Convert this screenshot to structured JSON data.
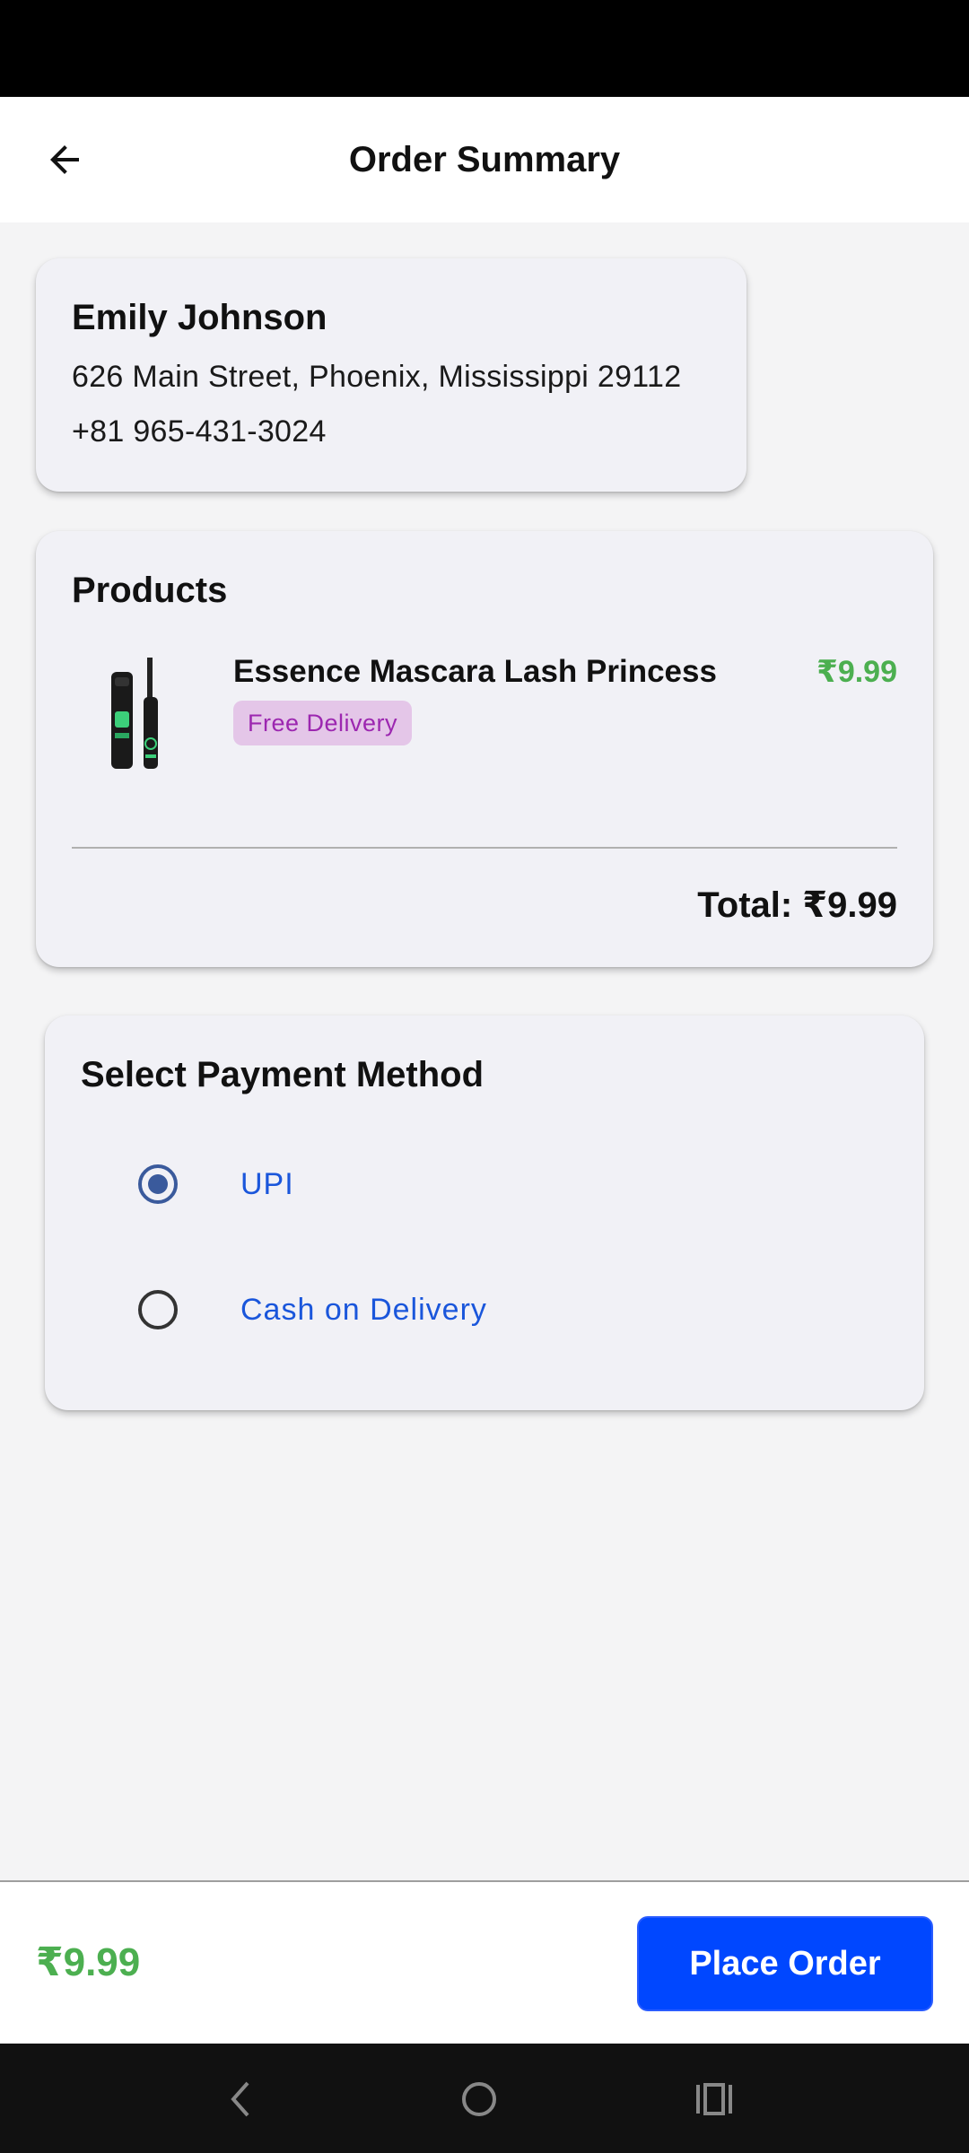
{
  "app_bar": {
    "title": "Order Summary",
    "back_icon": "arrow-left-icon"
  },
  "address": {
    "name": "Emily Johnson",
    "line1": "626 Main Street, Phoenix, Mississippi 29112",
    "phone": "+81 965-431-3024"
  },
  "products": {
    "title": "Products",
    "items": [
      {
        "name": "Essence Mascara Lash Princess",
        "price": "₹9.99",
        "badge": "Free Delivery",
        "image": "mascara-product-image"
      }
    ],
    "total": "Total: ₹9.99"
  },
  "payment": {
    "title": "Select Payment Method",
    "options": [
      {
        "label": "UPI",
        "selected": true
      },
      {
        "label": "Cash on Delivery",
        "selected": false
      }
    ]
  },
  "bottom": {
    "price": "₹9.99",
    "place_order_label": "Place Order"
  },
  "colors": {
    "price_green": "#4caf50",
    "link_blue": "#1a56db",
    "button_blue": "#0047ff",
    "badge_bg": "#e4c6e8",
    "badge_text": "#9c27b0",
    "radio_selected": "#3a5a9c"
  },
  "nav_icons": [
    "back-nav-icon",
    "home-nav-icon",
    "recents-nav-icon"
  ]
}
